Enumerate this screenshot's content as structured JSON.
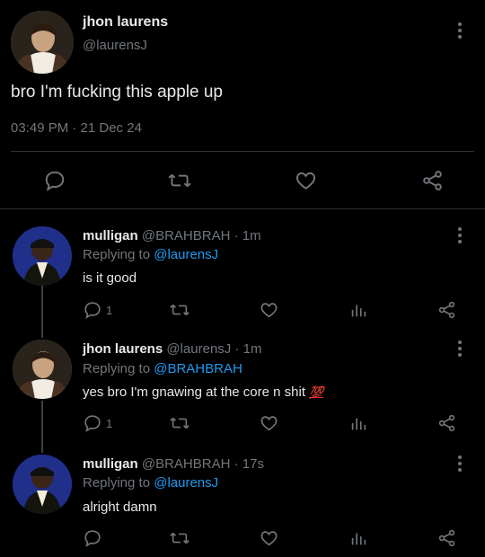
{
  "main_tweet": {
    "name": "jhon laurens",
    "handle": "@laurensJ",
    "text": "bro I'm fucking this apple up",
    "timestamp": "03:49 PM · 21 Dec 24",
    "actions": [
      "reply-icon",
      "retweet-icon",
      "like-icon",
      "share-icon"
    ]
  },
  "replies": [
    {
      "name": "mulligan",
      "handle": "@BRAHBRAH",
      "time": "· 1m",
      "replying_prefix": "Replying to ",
      "replying_to": "@laurensJ",
      "text": "is it good",
      "reply_count": "1",
      "emoji": ""
    },
    {
      "name": "jhon laurens",
      "handle": "@laurensJ",
      "time": "· 1m",
      "replying_prefix": "Replying to ",
      "replying_to": "@BRAHBRAH",
      "text": "yes bro I'm gnawing at the core n shit ",
      "reply_count": "1",
      "emoji": "💯"
    },
    {
      "name": "mulligan",
      "handle": "@BRAHBRAH",
      "time": "· 17s",
      "replying_prefix": "Replying to ",
      "replying_to": "@laurensJ",
      "text": "alright damn",
      "reply_count": "",
      "emoji": ""
    }
  ],
  "colors": {
    "background": "#000000",
    "text": "#e7e9ea",
    "secondary": "#71767b",
    "mention": "#1d9bf0"
  }
}
